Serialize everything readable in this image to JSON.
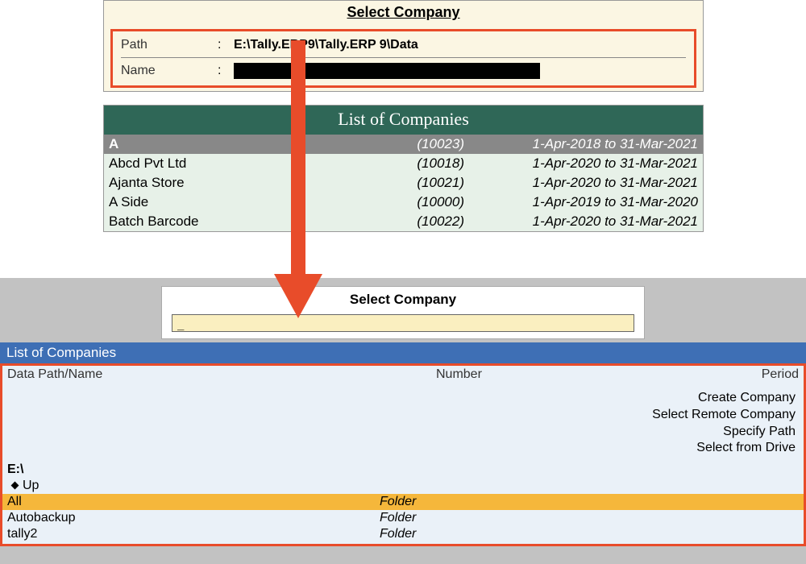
{
  "top": {
    "title": "Select Company",
    "path_label": "Path",
    "path_value": "E:\\Tally.ERP9\\Tally.ERP 9\\Data",
    "name_label": "Name"
  },
  "companies": {
    "header": "List of Companies",
    "highlighted": {
      "name": "A",
      "number": "(10023)",
      "period": "1-Apr-2018 to 31-Mar-2021"
    },
    "rows": [
      {
        "name": "Abcd Pvt Ltd",
        "number": "(10018)",
        "period": "1-Apr-2020 to 31-Mar-2021"
      },
      {
        "name": "Ajanta Store",
        "number": "(10021)",
        "period": "1-Apr-2020 to 31-Mar-2021"
      },
      {
        "name": "A Side",
        "number": "(10000)",
        "period": "1-Apr-2019 to 31-Mar-2020"
      },
      {
        "name": "Batch Barcode",
        "number": "(10022)",
        "period": "1-Apr-2020 to 31-Mar-2021"
      }
    ]
  },
  "bottom": {
    "title": "Select Company",
    "input_value": "_",
    "list_title": "List of Companies",
    "headers": {
      "name": "Data Path/Name",
      "number": "Number",
      "period": "Period"
    },
    "options": [
      "Create Company",
      "Select Remote Company",
      "Specify Path",
      "Select from Drive"
    ],
    "drive": "E:\\",
    "up_label": "Up",
    "folders": [
      {
        "name": "All",
        "type": "Folder",
        "selected": true
      },
      {
        "name": "Autobackup",
        "type": "Folder",
        "selected": false
      },
      {
        "name": "tally2",
        "type": "Folder",
        "selected": false
      }
    ]
  }
}
